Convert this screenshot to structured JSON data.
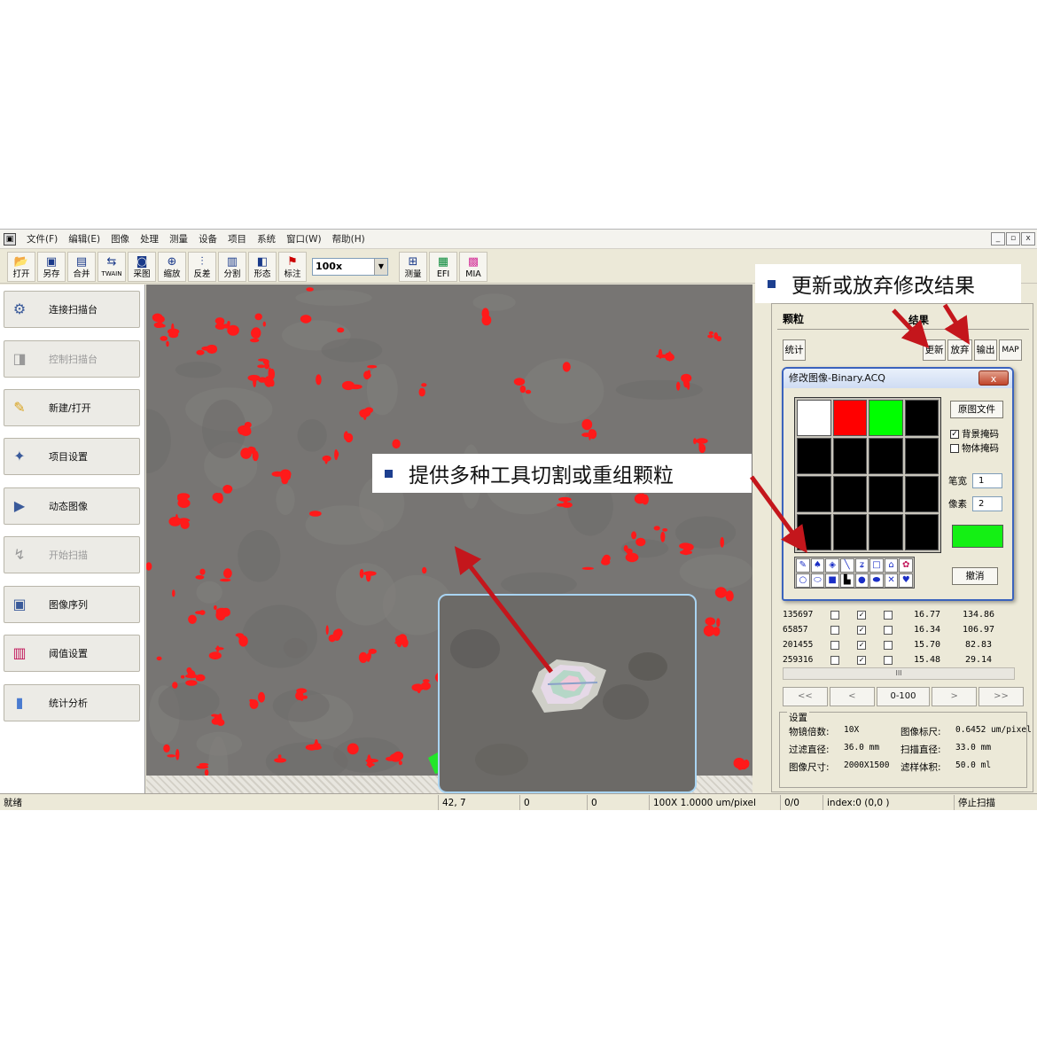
{
  "menu": {
    "items": [
      "文件(F)",
      "编辑(E)",
      "图像",
      "处理",
      "测量",
      "设备",
      "项目",
      "系统",
      "窗口(W)",
      "帮助(H)"
    ],
    "window_controls": [
      "_",
      "▫",
      "x"
    ]
  },
  "toolbar": {
    "buttons": [
      {
        "label": "打开",
        "icon": "open-icon"
      },
      {
        "label": "另存",
        "icon": "save-icon"
      },
      {
        "label": "合并",
        "icon": "merge-icon"
      },
      {
        "label": "TWAIN",
        "icon": "twain-icon"
      },
      {
        "label": "采图",
        "icon": "camera-icon"
      },
      {
        "label": "缩放",
        "icon": "zoom-icon"
      },
      {
        "label": "反差",
        "icon": "contrast-icon"
      },
      {
        "label": "分割",
        "icon": "split-icon"
      },
      {
        "label": "形态",
        "icon": "morph-icon"
      },
      {
        "label": "标注",
        "icon": "flag-icon"
      }
    ],
    "zoom_value": "100x",
    "buttons_right": [
      {
        "label": "测量",
        "icon": "measure-icon"
      },
      {
        "label": "EFI",
        "icon": "efi-icon"
      },
      {
        "label": "MIA",
        "icon": "mia-icon"
      }
    ]
  },
  "sidebar": {
    "items": [
      {
        "label": "连接扫描台",
        "icon": "connect-stage-icon",
        "enabled": true
      },
      {
        "label": "控制扫描台",
        "icon": "control-stage-icon",
        "enabled": false
      },
      {
        "label": "新建/打开",
        "icon": "new-open-icon",
        "enabled": true
      },
      {
        "label": "项目设置",
        "icon": "project-settings-icon",
        "enabled": true
      },
      {
        "label": "动态图像",
        "icon": "live-image-icon",
        "enabled": true
      },
      {
        "label": "开始扫描",
        "icon": "start-scan-icon",
        "enabled": false
      },
      {
        "label": "图像序列",
        "icon": "image-sequence-icon",
        "enabled": true
      },
      {
        "label": "阈值设置",
        "icon": "threshold-icon",
        "enabled": true
      },
      {
        "label": "统计分析",
        "icon": "statistics-icon",
        "enabled": true
      }
    ]
  },
  "right_panel": {
    "title": "颗粒",
    "result_label": "结果",
    "buttons": {
      "stats": "统计",
      "update": "更新",
      "discard": "放弃",
      "export": "输出",
      "map": "MAP"
    },
    "rows": [
      {
        "id": "135697",
        "c1": false,
        "c2": true,
        "c3": false,
        "v1": "16.77",
        "v2": "134.86"
      },
      {
        "id": "65857",
        "c1": false,
        "c2": true,
        "c3": false,
        "v1": "16.34",
        "v2": "106.97"
      },
      {
        "id": "201455",
        "c1": false,
        "c2": true,
        "c3": false,
        "v1": "15.70",
        "v2": "82.83"
      },
      {
        "id": "259316",
        "c1": false,
        "c2": true,
        "c3": false,
        "v1": "15.48",
        "v2": "29.14"
      }
    ],
    "scroll_thumb": "III",
    "pager": {
      "first": "<<",
      "prev": "<",
      "range": "0-100",
      "next": ">",
      "last": ">>"
    },
    "settings": {
      "legend": "设置",
      "objective_label": "物镜倍数:",
      "objective_value": "10X",
      "scale_label": "图像标尺:",
      "scale_value": "0.6452 um/pixel",
      "filter_label": "过滤直径:",
      "filter_value": "36.0 mm",
      "scan_label": "扫描直径:",
      "scan_value": "33.0 mm",
      "size_label": "图像尺寸:",
      "size_value": "2000X1500",
      "volume_label": "滤样体积:",
      "volume_value": "50.0 ml"
    }
  },
  "dialog": {
    "title": "修改图像-Binary.ACQ",
    "close": "x",
    "original_button": "原图文件",
    "bg_mask": "背景掩码",
    "bg_mask_checked": true,
    "obj_mask": "物体掩码",
    "obj_mask_checked": false,
    "pen_width_label": "笔宽",
    "pen_width_value": "1",
    "pixel_label": "像素",
    "pixel_value": "2",
    "cancel_button": "撤消",
    "palette": [
      "#ffffff",
      "#ff0000",
      "#00ff00",
      "#000000",
      "#000000",
      "#000000",
      "#000000",
      "#000000",
      "#000000",
      "#000000",
      "#000000",
      "#000000",
      "#000000",
      "#000000",
      "#000000",
      "#000000"
    ],
    "preview_color": "#14f014"
  },
  "status_bar": {
    "status": "就绪",
    "coords": "42, 7",
    "v1": "0",
    "v2": "0",
    "scale": "100X  1.0000 um/pixel",
    "count": "0/0",
    "index": "index:0 (0,0 )",
    "scan_state": "停止扫描"
  },
  "callouts": {
    "top": "更新或放弃修改结果",
    "middle": "提供多种工具切割或重组颗粒"
  },
  "colors": {
    "particle_red": "#ff1a1a",
    "particle_green": "#22e62a",
    "arrow_red": "#c4161c",
    "bullet_blue": "#1d3f8f"
  }
}
